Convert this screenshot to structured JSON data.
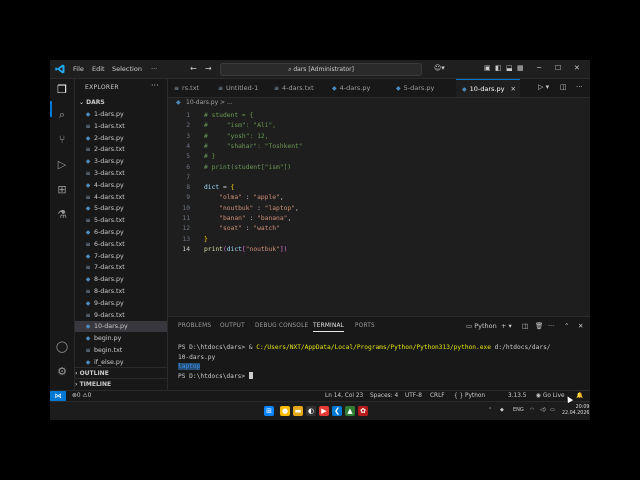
{
  "titlebar": {
    "menus": [
      "File",
      "Edit",
      "Selection"
    ],
    "more": "···",
    "search_text": "dars [Administrator]"
  },
  "sidebar": {
    "title": "EXPLORER",
    "more": "···",
    "folder": "DARS",
    "files": [
      {
        "name": "1-dars.py",
        "type": "py"
      },
      {
        "name": "1-dars.txt",
        "type": "txt"
      },
      {
        "name": "2-dars.py",
        "type": "py"
      },
      {
        "name": "2-dars.txt",
        "type": "txt"
      },
      {
        "name": "3-dars.py",
        "type": "py"
      },
      {
        "name": "3-dars.txt",
        "type": "txt"
      },
      {
        "name": "4-dars.py",
        "type": "py"
      },
      {
        "name": "4-dars.txt",
        "type": "txt"
      },
      {
        "name": "5-dars.py",
        "type": "py"
      },
      {
        "name": "5-dars.txt",
        "type": "txt"
      },
      {
        "name": "6-dars.py",
        "type": "py"
      },
      {
        "name": "6-dars.txt",
        "type": "txt"
      },
      {
        "name": "7-dars.py",
        "type": "py"
      },
      {
        "name": "7-dars.txt",
        "type": "txt"
      },
      {
        "name": "8-dars.py",
        "type": "py"
      },
      {
        "name": "8-dars.txt",
        "type": "txt"
      },
      {
        "name": "9-dars.py",
        "type": "py"
      },
      {
        "name": "9-dars.txt",
        "type": "txt"
      },
      {
        "name": "10-dars.py",
        "type": "py",
        "selected": true
      },
      {
        "name": "begin.py",
        "type": "py"
      },
      {
        "name": "begin.txt",
        "type": "txt"
      },
      {
        "name": "if_else.py",
        "type": "py"
      }
    ],
    "outline": "OUTLINE",
    "timeline": "TIMELINE"
  },
  "tabs": [
    {
      "label": "rs.txt",
      "icon": "txt"
    },
    {
      "label": "Untitled-1",
      "icon": "txt"
    },
    {
      "label": "4-dars.txt",
      "icon": "txt"
    },
    {
      "label": "4-dars.py",
      "icon": "py"
    },
    {
      "label": "5-dars.py",
      "icon": "py"
    },
    {
      "label": "10-dars.py",
      "icon": "py",
      "active": true
    }
  ],
  "breadcrumb": "10-dars.py > ...",
  "editor": {
    "lines": [
      {
        "n": "1",
        "text": "# student = {"
      },
      {
        "n": "2",
        "text": "#     \"ism\": \"Ali\","
      },
      {
        "n": "3",
        "text": "#     \"yosh\": 12,"
      },
      {
        "n": "4",
        "text": "#     \"shahar\": \"Toshkent\""
      },
      {
        "n": "5",
        "text": "# }"
      },
      {
        "n": "6",
        "text": "# print(student[\"ism\"])"
      },
      {
        "n": "7",
        "text": ""
      },
      {
        "n": "8",
        "text": "dict = {"
      },
      {
        "n": "9",
        "text": "    \"olma\" : \"apple\","
      },
      {
        "n": "10",
        "text": "    \"noutbuk\" : \"laptop\","
      },
      {
        "n": "11",
        "text": "    \"banan\" : \"banana\","
      },
      {
        "n": "12",
        "text": "    \"soat\" : \"watch\""
      },
      {
        "n": "13",
        "text": "}"
      },
      {
        "n": "14",
        "text": "print(dict[\"noutbuk\"])"
      }
    ]
  },
  "panel": {
    "tabs": [
      "PROBLEMS",
      "OUTPUT",
      "DEBUG CONSOLE",
      "TERMINAL",
      "PORTS"
    ],
    "active_tab": "TERMINAL",
    "shell": "Python",
    "terminal": {
      "prompt1": "PS D:\\htdocs\\dars> ",
      "amp": "& ",
      "exe": "C:/Users/NXT/AppData/Local/Programs/Python/Python313/python.exe",
      "arg1": " d:/htdocs/dars/",
      "arg2": "10-dars.py",
      "output": "laptop",
      "prompt2": "PS D:\\htdocs\\dars> "
    }
  },
  "statusbar": {
    "errors": "0",
    "warnings": "0",
    "position": "Ln 14, Col 23",
    "spaces": "Spaces: 4",
    "encoding": "UTF-8",
    "eol": "CRLF",
    "braces": "{ }",
    "language": "Python",
    "version": "3.13.5",
    "golive": "Go Live"
  },
  "taskbar": {
    "lang": "ENG",
    "time": "20:09",
    "date": "22.04.2026"
  },
  "colors": {
    "accent": "#0078d4",
    "editor_bg": "#1e1e1e",
    "sidebar_bg": "#181818",
    "comment": "#6a9955",
    "string": "#ce9178",
    "variable": "#9cdcfe"
  }
}
